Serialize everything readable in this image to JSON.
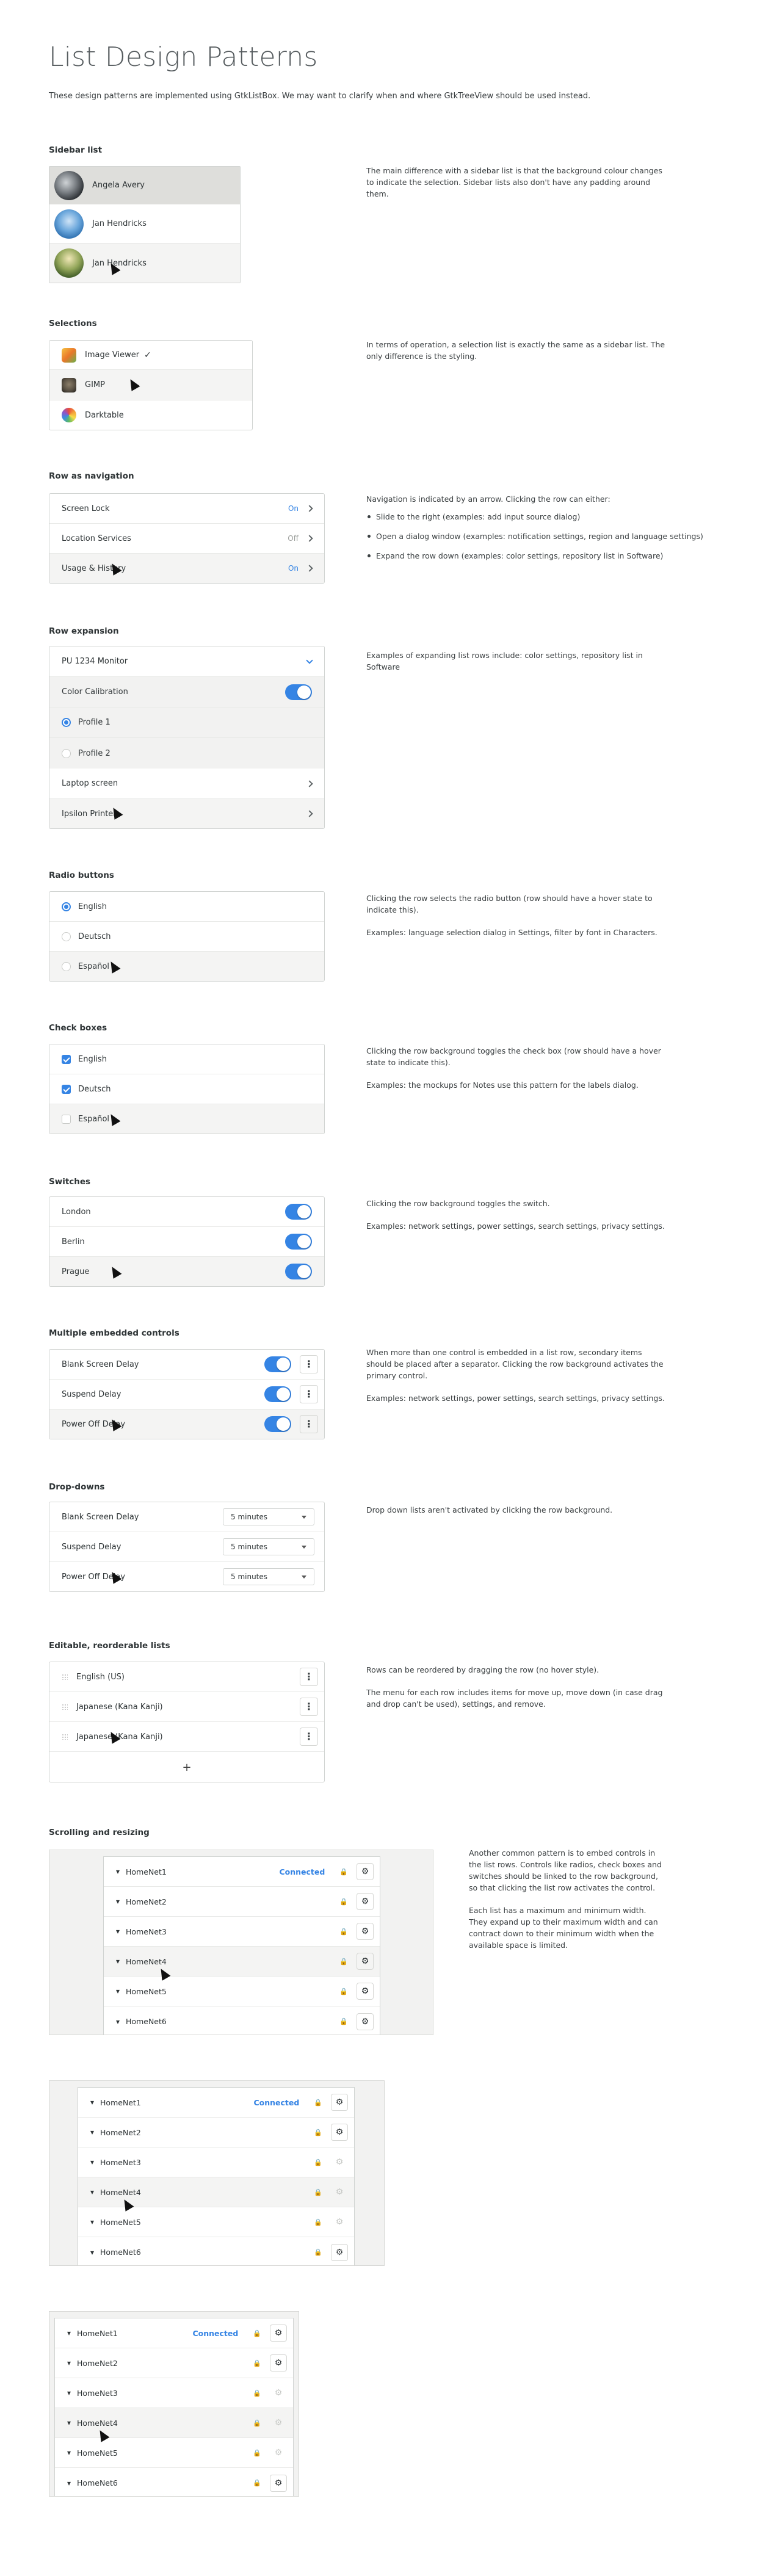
{
  "title": "List Design Patterns",
  "intro": "These design patterns are implemented using GtkListBox. We may want to clarify when and where GtkTreeView should be used instead.",
  "sections": {
    "sidebar": {
      "heading": "Sidebar list",
      "items": [
        "Angela Avery",
        "Jan Hendricks",
        "Jan Hendricks"
      ],
      "desc": [
        "The main difference with a sidebar list is that the background colour changes to indicate the selection. Sidebar lists also don't have any padding around them."
      ]
    },
    "selections": {
      "heading": "Selections",
      "items": [
        "Image Viewer",
        "GIMP",
        "Darktable"
      ],
      "check": "✓",
      "desc": [
        "In terms of operation, a selection list is exactly the same as a sidebar list. The only difference is the styling."
      ]
    },
    "navigation": {
      "heading": "Row as navigation",
      "items": [
        {
          "label": "Screen Lock",
          "value": "On"
        },
        {
          "label": "Location Services",
          "value": "Off"
        },
        {
          "label": "Usage & History",
          "value": "On"
        }
      ],
      "desc_intro": "Navigation is indicated by an arrow. Clicking the row can either:",
      "bullets": [
        "Slide to the right (examples: add input source dialog)",
        "Open a dialog window (examples: notification settings, region and language settings)",
        "Expand the row down (examples: color settings, repository list in Software)"
      ]
    },
    "expansion": {
      "heading": "Row expansion",
      "header": "PU 1234 Monitor",
      "sub_header": "Color Calibration",
      "profiles": [
        "Profile 1",
        "Profile 2"
      ],
      "items": [
        "Laptop screen",
        "Ipsilon Printer"
      ],
      "desc": [
        "Examples of expanding list rows include: color settings, repository list in Software"
      ]
    },
    "radio": {
      "heading": "Radio buttons",
      "items": [
        "English",
        "Deutsch",
        "Español"
      ],
      "desc": [
        "Clicking the row selects the radio button (row should have a hover state to indicate this).",
        "Examples: language selection dialog in Settings, filter by font in Characters."
      ]
    },
    "checkboxes": {
      "heading": "Check boxes",
      "items": [
        "English",
        "Deutsch",
        "Español"
      ],
      "desc": [
        "Clicking the row background toggles the check box (row should have a hover state to indicate this).",
        "Examples: the mockups for Notes use this pattern for the labels dialog."
      ]
    },
    "switches": {
      "heading": "Switches",
      "items": [
        "London",
        "Berlin",
        "Prague"
      ],
      "desc": [
        "Clicking the row background toggles the switch.",
        "Examples: network settings, power settings, search settings, privacy settings."
      ]
    },
    "multiple": {
      "heading": "Multiple embedded controls",
      "items": [
        "Blank Screen Delay",
        "Suspend Delay",
        "Power Off Delay"
      ],
      "menu_glyph": "⋮",
      "desc": [
        "When more than one control is embedded in a list row, secondary items should be placed after a separator. Clicking the row background activates the primary control.",
        "Examples: network settings, power settings, search settings, privacy settings."
      ]
    },
    "dropdowns": {
      "heading": "Drop-downs",
      "items": [
        {
          "label": "Blank Screen Delay",
          "value": "5 minutes"
        },
        {
          "label": "Suspend Delay",
          "value": "5 minutes"
        },
        {
          "label": "Power Off Delay",
          "value": "5 minutes"
        }
      ],
      "desc": [
        "Drop down lists aren't activated by clicking the row background."
      ]
    },
    "editable": {
      "heading": "Editable, reorderable lists",
      "items": [
        "English (US)",
        "Japanese (Kana Kanji)",
        "Japanese (Kana Kanji)"
      ],
      "add": "+",
      "desc": [
        "Rows can be reordered by dragging the row (no hover style).",
        "The menu for each row includes items for move up, move down (in case drag and drop can't be used), settings, and remove."
      ]
    },
    "scrolling": {
      "heading": "Scrolling and resizing",
      "networks": [
        "HomeNet1",
        "HomeNet2",
        "HomeNet3",
        "HomeNet4",
        "HomeNet5",
        "HomeNet6"
      ],
      "connected": "Connected",
      "lock_glyph": "🔒",
      "gear_glyph": "⚙",
      "wifi_glyph": "▾",
      "desc": [
        "Another common pattern is to embed controls in the list rows. Controls like radios, check boxes and switches should be linked to the row background, so that clicking the list row activates the control.",
        "Each list has a maximum and minimum width. They expand up to their maximum width and can contract down to their minimum width when the available space is limited."
      ]
    }
  },
  "colors": {
    "accent": "#3584e4",
    "selected_row": "#dededb",
    "hover_row": "#f4f4f3"
  }
}
